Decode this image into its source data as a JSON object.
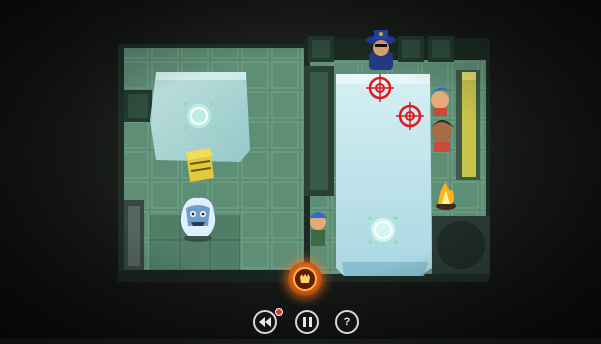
{
  "game": {
    "title": "",
    "board": {
      "left_room_floor": "stone",
      "right_room_floor": "ice"
    },
    "entities": [
      {
        "kind": "player",
        "name": "yeti"
      },
      {
        "kind": "npc",
        "name": "police-officer"
      },
      {
        "kind": "npc",
        "name": "blue-haired-guard"
      },
      {
        "kind": "npc",
        "name": "brown-haired-guard"
      },
      {
        "kind": "npc",
        "name": "kid-with-blue-cap"
      },
      {
        "kind": "object",
        "name": "yellow-crate"
      },
      {
        "kind": "object",
        "name": "fire"
      },
      {
        "kind": "object",
        "name": "spinning-fan"
      }
    ],
    "markers": {
      "targets": 2,
      "waypoints": 3
    }
  },
  "controls": {
    "rewind": {
      "icon": "rewind-icon",
      "has_badge": true
    },
    "pause": {
      "icon": "pause-icon"
    },
    "help": {
      "label": "?",
      "icon": "help-icon"
    },
    "ability": {
      "icon": "roar-icon",
      "active": true
    }
  },
  "colors": {
    "background": "#151816",
    "wall": "#2f4a3e",
    "floor": "#5f8a72",
    "ice": "#bfe6ee",
    "target": "#e0191f",
    "ability_glow": "#ff8a20",
    "badge": "#e23b2e",
    "crate": "#e2c93a"
  }
}
